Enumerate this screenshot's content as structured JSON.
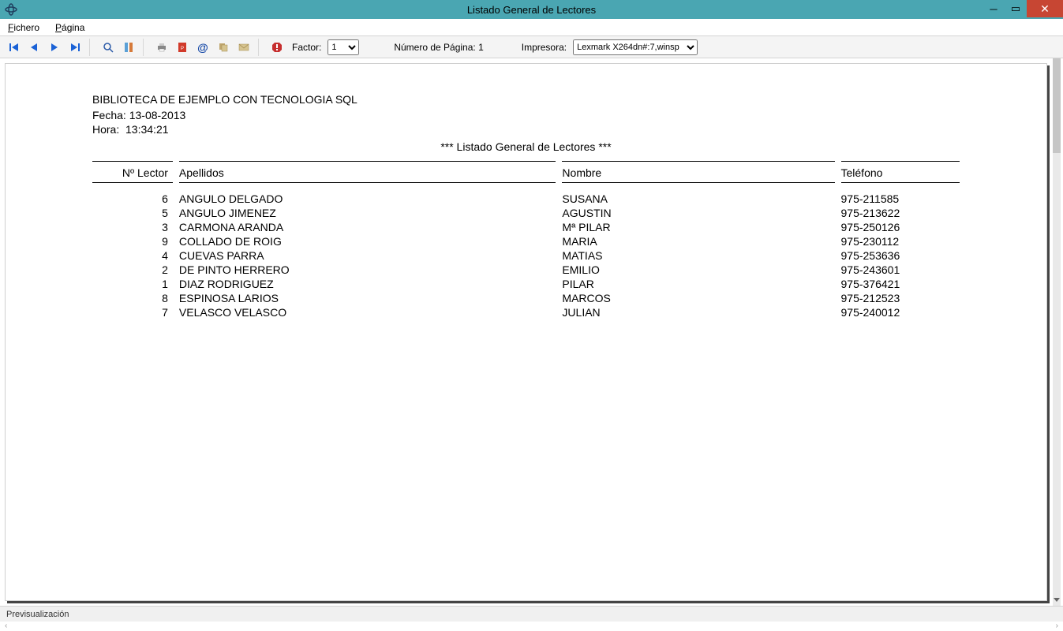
{
  "window": {
    "title": "Listado General de Lectores"
  },
  "menu": {
    "fichero": "Fichero",
    "pagina": "Página"
  },
  "toolbar": {
    "factor_label": "Factor:",
    "factor_value": "1",
    "page_label": "Número de Página: 1",
    "printer_label": "Impresora:",
    "printer_value": "Lexmark X264dn#:7,winsp"
  },
  "report": {
    "library": "BIBLIOTECA DE EJEMPLO CON TECNOLOGIA SQL",
    "date_label": "Fecha:",
    "date_value": "13-08-2013",
    "time_label": "Hora:",
    "time_value": "13:34:21",
    "title": "*** Listado General de Lectores ***"
  },
  "columns": {
    "num": "Nº Lector",
    "apellidos": "Apellidos",
    "nombre": "Nombre",
    "telefono": "Teléfono"
  },
  "rows": [
    {
      "num": "6",
      "apellidos": "ANGULO DELGADO",
      "nombre": "SUSANA",
      "telefono": "975-211585"
    },
    {
      "num": "5",
      "apellidos": "ANGULO JIMENEZ",
      "nombre": "AGUSTIN",
      "telefono": "975-213622"
    },
    {
      "num": "3",
      "apellidos": "CARMONA ARANDA",
      "nombre": "Mª PILAR",
      "telefono": "975-250126"
    },
    {
      "num": "9",
      "apellidos": "COLLADO DE ROIG",
      "nombre": "MARIA",
      "telefono": "975-230112"
    },
    {
      "num": "4",
      "apellidos": "CUEVAS PARRA",
      "nombre": "MATIAS",
      "telefono": "975-253636"
    },
    {
      "num": "2",
      "apellidos": "DE PINTO HERRERO",
      "nombre": "EMILIO",
      "telefono": "975-243601"
    },
    {
      "num": "1",
      "apellidos": "DIAZ RODRIGUEZ",
      "nombre": "PILAR",
      "telefono": "975-376421"
    },
    {
      "num": "8",
      "apellidos": "ESPINOSA LARIOS",
      "nombre": "MARCOS",
      "telefono": "975-212523"
    },
    {
      "num": "7",
      "apellidos": "VELASCO VELASCO",
      "nombre": "JULIAN",
      "telefono": "975-240012"
    }
  ],
  "status": {
    "text": "Previsualización"
  }
}
